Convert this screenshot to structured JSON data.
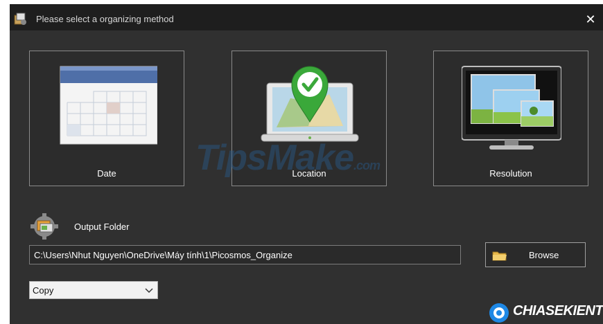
{
  "window": {
    "title": "Please select a organizing method",
    "close_glyph": "✕"
  },
  "methods": [
    {
      "label": "Date",
      "icon": "calendar-icon"
    },
    {
      "label": "Location",
      "icon": "map-laptop-icon"
    },
    {
      "label": "Resolution",
      "icon": "monitor-icon"
    }
  ],
  "watermark": {
    "text": "TipsMake",
    "suffix": ".com"
  },
  "output": {
    "label": "Output Folder",
    "path": "C:\\Users\\Nhut Nguyen\\OneDrive\\Máy tính\\1\\Picosmos_Organize",
    "browse_label": "Browse"
  },
  "action_select": {
    "value": "Copy"
  },
  "brand": {
    "text": "CHIASEKIENTHUC"
  },
  "colors": {
    "background": "#303030",
    "titlebar": "#1e1e1e",
    "text": "#ffffff",
    "accent_green": "#3aa83a"
  }
}
